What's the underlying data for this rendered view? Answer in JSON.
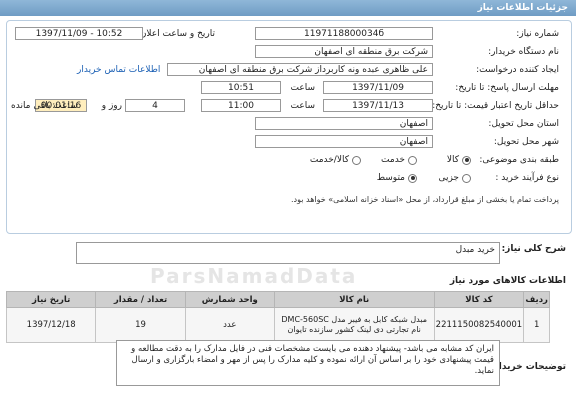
{
  "title": "جزئیات اطلاعات نیاز",
  "need_number": {
    "label": "شماره نیاز:",
    "value": "1197118800034б"
  },
  "announce": {
    "label": "تاریخ و ساعت اعلان عمومی:",
    "value": "1397/11/09 - 10:52"
  },
  "buyer_org": {
    "label": "نام دستگاه خریدار:",
    "value": "شرکت برق منطقه ای اصفهان"
  },
  "creator": {
    "label": "ایجاد کننده درخواست:",
    "value": "علی ظاهری عبده ونه کاربرداز شرکت برق منطقه ای اصفهان",
    "contact_link": "اطلاعات تماس خریدار"
  },
  "send_deadline": {
    "label": "مهلت ارسال پاسخ: تا تاریخ:",
    "date": "1397/11/09",
    "time_label": "ساعت",
    "time": "10:51"
  },
  "validity": {
    "label": "حداقل تاریخ اعتبار قیمت: تا تاریخ:",
    "date": "1397/11/13",
    "time_label": "ساعت",
    "time": "11:00",
    "days": "4",
    "days_label": "روز و",
    "remaining": "00:01:16",
    "remaining_label": "ساعت باقی مانده"
  },
  "province": {
    "label": "استان محل تحویل:",
    "value": "اصفهان"
  },
  "city": {
    "label": "شهر محل تحویل:",
    "value": "اصفهان"
  },
  "category": {
    "label": "طبقه بندی موضوعی:",
    "options": [
      "کالا",
      "خدمت",
      "کالا/خدمت"
    ],
    "selected": 0
  },
  "process": {
    "label": "نوع فرآیند خرید :",
    "options": [
      "جزیی",
      "متوسط"
    ],
    "selected": 1,
    "note": "پرداخت تمام یا بخشی از مبلغ قرارداد، از محل «اسناد خزانه اسلامی» خواهد بود."
  },
  "description": {
    "label": "شرح کلی نیاز:",
    "value": "خرید مبدل"
  },
  "goods": {
    "label": "اطلاعات کالاهای مورد نیاز",
    "headers": [
      "ردیف",
      "کد کالا",
      "نام کالا",
      "واحد شمارش",
      "تعداد / مقدار",
      "تاریخ نیاز"
    ],
    "rows": [
      {
        "row": "1",
        "code": "2211150082540001",
        "name": "مبدل شبکه کابل به فیبر مدل DMC-560SC نام تجارتی دی لینک کشور سازنده تایوان",
        "unit": "عدد",
        "qty": "19",
        "date": "1397/12/18"
      }
    ]
  },
  "buyer_notes": {
    "label": "توضیحات خریدار:",
    "value": "ایران کد مشابه می باشد- پیشنهاد دهنده می بایست مشخصات فنی در فایل مدارک  را به دقت مطالعه و قیمت پیشنهادی خود را بر اساس آن ارائه نموده و کلیه مدارک را پس از مهر و امضاء بارگزاری و ارسال نماید."
  },
  "watermark": "ParsNamadData",
  "colors": {
    "titlebar": "#7ba7cf",
    "link": "#1a5fb4",
    "table_header": "#cfcfcf"
  }
}
